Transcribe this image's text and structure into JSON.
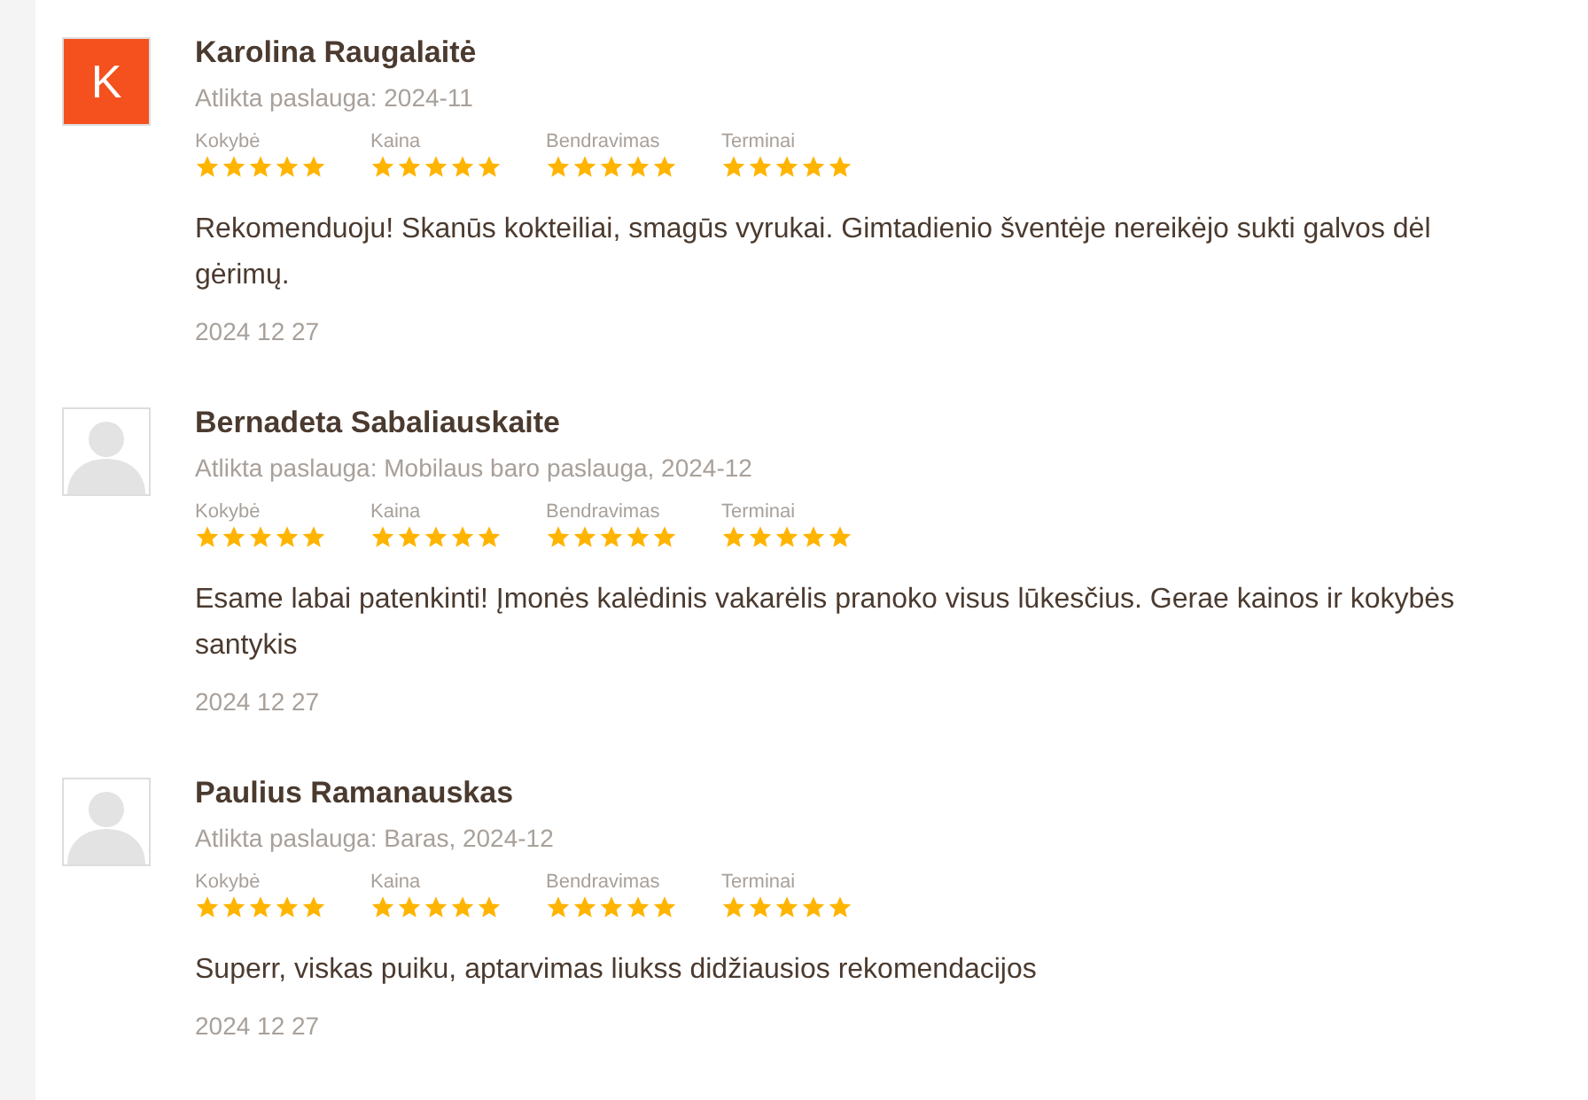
{
  "reviews": [
    {
      "avatar": {
        "kind": "initial",
        "letter": "K"
      },
      "name": "Karolina Raugalaitė",
      "service": "Atlikta paslauga: 2024-11",
      "ratings": [
        {
          "label": "Kokybė",
          "stars": 5
        },
        {
          "label": "Kaina",
          "stars": 5
        },
        {
          "label": "Bendravimas",
          "stars": 5
        },
        {
          "label": "Terminai",
          "stars": 5
        }
      ],
      "comment": "Rekomenduoju! Skanūs kokteiliai, smagūs vyrukai. Gimtadienio šventėje nereikėjo sukti galvos dėl gėrimų.",
      "date": "2024 12 27"
    },
    {
      "avatar": {
        "kind": "placeholder"
      },
      "name": "Bernadeta Sabaliauskaite",
      "service": "Atlikta paslauga: Mobilaus baro paslauga, 2024-12",
      "ratings": [
        {
          "label": "Kokybė",
          "stars": 5
        },
        {
          "label": "Kaina",
          "stars": 5
        },
        {
          "label": "Bendravimas",
          "stars": 5
        },
        {
          "label": "Terminai",
          "stars": 5
        }
      ],
      "comment": "Esame labai patenkinti! Įmonės kalėdinis vakarėlis pranoko visus lūkesčius. Gerae kainos ir kokybės santykis",
      "date": "2024 12 27"
    },
    {
      "avatar": {
        "kind": "placeholder"
      },
      "name": "Paulius Ramanauskas",
      "service": "Atlikta paslauga: Baras, 2024-12",
      "ratings": [
        {
          "label": "Kokybė",
          "stars": 5
        },
        {
          "label": "Kaina",
          "stars": 5
        },
        {
          "label": "Bendravimas",
          "stars": 5
        },
        {
          "label": "Terminai",
          "stars": 5
        }
      ],
      "comment": "Superr, viskas puiku, aptarvimas liukss didžiausios rekomendacijos",
      "date": "2024 12 27"
    }
  ]
}
